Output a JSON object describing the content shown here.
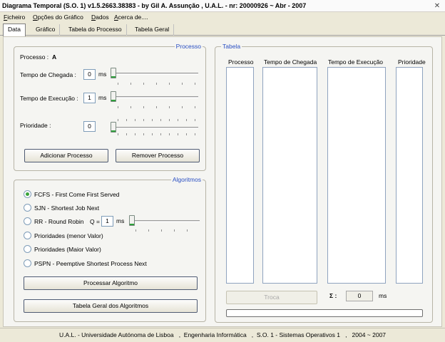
{
  "window": {
    "title": "Diagrama Temporal (S.O. 1) v1.5.2663.38383 - by Gil A. Assunção , U.A.L. - nr: 20000926 ~ Abr - 2007",
    "close_glyph": "✕"
  },
  "menu": [
    "Ficheiro",
    "Opções do Gráfico",
    "Dados",
    "Acerca de...."
  ],
  "tabs": [
    "Data",
    "Gráfico",
    "Tabela do Processo",
    "Tabela Geral"
  ],
  "processo_group": {
    "legend": "Processo",
    "processo_label": "Processo :",
    "processo_value": "A",
    "chegada_label": "Tempo de Chegada :",
    "chegada_value": "0",
    "chegada_unit": "ms",
    "execucao_label": "Tempo de Execução :",
    "execucao_value": "1",
    "execucao_unit": "ms",
    "prioridade_label": "Prioridade :",
    "prioridade_value": "0",
    "add_button": "Adicionar Processo",
    "remove_button": "Remover Processo"
  },
  "algoritmos_group": {
    "legend": "Algoritmos",
    "options": [
      "FCFS - First Come First Served",
      "SJN - Shortest Job Next",
      "RR - Round Robin",
      "Prioridades (menor Valor)",
      "Prioridades (Maior Valor)",
      "PSPN - Peemptive Shortest Process Next"
    ],
    "selected": "FCFS - First Come First Served",
    "quantum_label": "Q =",
    "quantum_value": "1",
    "quantum_unit": "ms",
    "process_button": "Processar Algoritmo",
    "table_button": "Tabela Geral dos Algoritmos"
  },
  "tabela_group": {
    "legend": "Tabela",
    "columns": [
      "Processo",
      "Tempo de Chegada",
      "Tempo de Execução",
      "Prioridade"
    ],
    "troca_button": "Troca",
    "sigma_label": "Σ :",
    "sigma_value": "0",
    "sigma_unit": "ms",
    "progress": 0
  },
  "status": "U.A.L. - Universidade Autónoma de Lisboa   ,  Engenharia Informática   ,  S.O. 1 - Sistemas Operativos 1   ,   2004 ~ 2007"
}
